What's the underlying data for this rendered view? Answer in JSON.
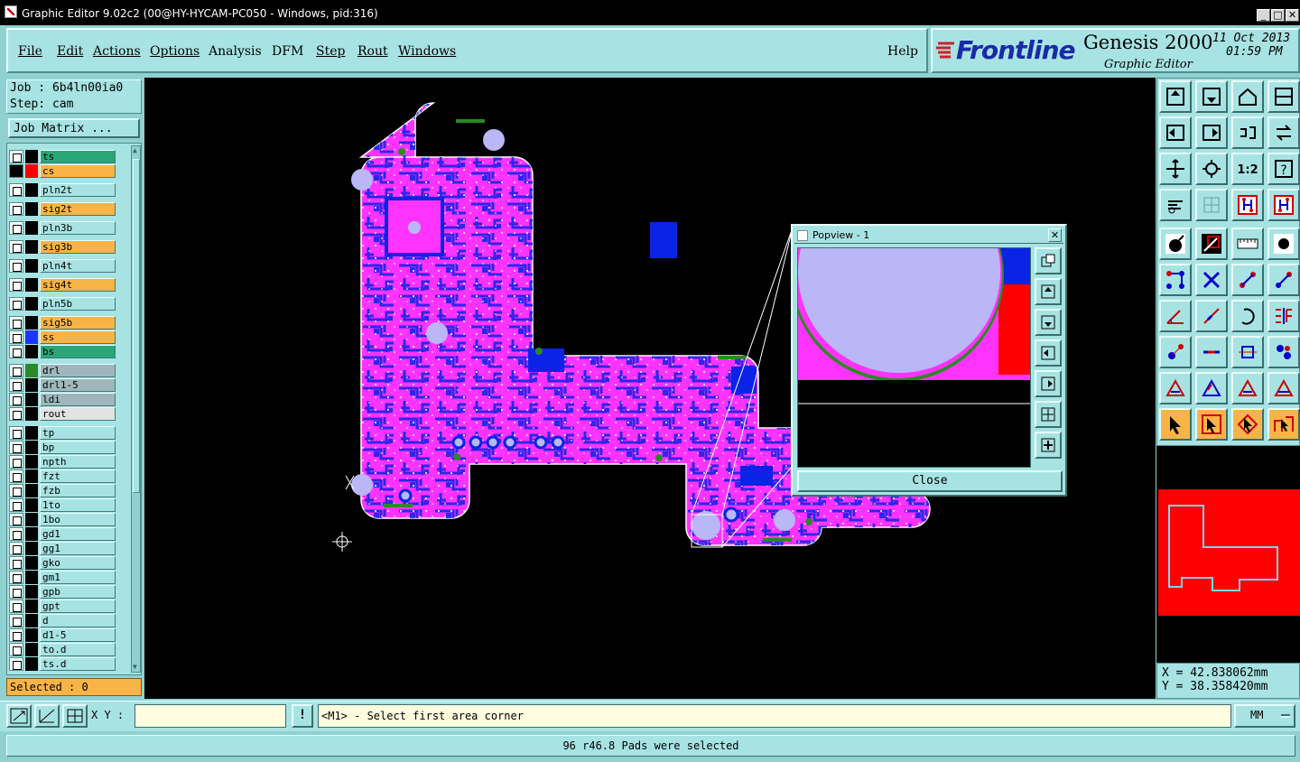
{
  "window": {
    "title": "Graphic Editor 9.02c2 (00@HY-HYCAM-PC050 - Windows, pid:316)",
    "controls": [
      "_",
      "□",
      "✕"
    ]
  },
  "menu": {
    "items": [
      {
        "label": "File"
      },
      {
        "label": "Edit"
      },
      {
        "label": "Actions"
      },
      {
        "label": "Options"
      },
      {
        "label": "Analysis"
      },
      {
        "label": "DFM"
      },
      {
        "label": "Step"
      },
      {
        "label": "Rout"
      },
      {
        "label": "Windows"
      }
    ],
    "help": "Help"
  },
  "brand": {
    "logo_text": "Frontline",
    "product": "Genesis 2000",
    "subtitle": "Graphic Editor",
    "date": "11 Oct 2013",
    "time": "01:59 PM"
  },
  "job": {
    "job_label": "Job : 6b4ln00ia0",
    "step_label": "Step: cam",
    "matrix_button": "Job Matrix ..."
  },
  "layers": [
    {
      "name": "ts",
      "swatch": "#000000",
      "bg": "#2aa676"
    },
    {
      "name": "cs",
      "swatch": "#ff0000",
      "bg": "#f9b447",
      "active": true
    },
    {
      "name": "pln2t",
      "swatch": "#000000",
      "bg": "#a8e3e3"
    },
    {
      "name": "sig2t",
      "swatch": "#000000",
      "bg": "#f9b447"
    },
    {
      "name": "pln3b",
      "swatch": "#000000",
      "bg": "#a8e3e3"
    },
    {
      "name": "sig3b",
      "swatch": "#000000",
      "bg": "#f9b447"
    },
    {
      "name": "pln4t",
      "swatch": "#000000",
      "bg": "#a8e3e3"
    },
    {
      "name": "sig4t",
      "swatch": "#000000",
      "bg": "#f9b447"
    },
    {
      "name": "pln5b",
      "swatch": "#000000",
      "bg": "#a8e3e3"
    },
    {
      "name": "sig5b",
      "swatch": "#000000",
      "bg": "#f9b447"
    },
    {
      "name": "ss",
      "swatch": "#1f33ff",
      "bg": "#f9b447"
    },
    {
      "name": "bs",
      "swatch": "#000000",
      "bg": "#2aa676"
    },
    {
      "name": "drl",
      "swatch": "#2a8a2a",
      "bg": "#9fb7bb"
    },
    {
      "name": "drl1-5",
      "swatch": "#000000",
      "bg": "#9fb7bb"
    },
    {
      "name": "ldi",
      "swatch": "#000000",
      "bg": "#9fb7bb"
    },
    {
      "name": "rout",
      "swatch": "#000000",
      "bg": "#e3e3e3"
    },
    {
      "name": "tp",
      "swatch": "#000000",
      "bg": "#a8e3e3"
    },
    {
      "name": "bp",
      "swatch": "#000000",
      "bg": "#a8e3e3"
    },
    {
      "name": "npth",
      "swatch": "#000000",
      "bg": "#a8e3e3"
    },
    {
      "name": "fzt",
      "swatch": "#000000",
      "bg": "#a8e3e3"
    },
    {
      "name": "fzb",
      "swatch": "#000000",
      "bg": "#a8e3e3"
    },
    {
      "name": "1to",
      "swatch": "#000000",
      "bg": "#a8e3e3"
    },
    {
      "name": "1bo",
      "swatch": "#000000",
      "bg": "#a8e3e3"
    },
    {
      "name": "gd1",
      "swatch": "#000000",
      "bg": "#a8e3e3"
    },
    {
      "name": "gg1",
      "swatch": "#000000",
      "bg": "#a8e3e3"
    },
    {
      "name": "gko",
      "swatch": "#000000",
      "bg": "#a8e3e3"
    },
    {
      "name": "gm1",
      "swatch": "#000000",
      "bg": "#a8e3e3"
    },
    {
      "name": "gpb",
      "swatch": "#000000",
      "bg": "#a8e3e3"
    },
    {
      "name": "gpt",
      "swatch": "#000000",
      "bg": "#a8e3e3"
    },
    {
      "name": "d",
      "swatch": "#000000",
      "bg": "#a8e3e3"
    },
    {
      "name": "d1-5",
      "swatch": "#000000",
      "bg": "#a8e3e3"
    },
    {
      "name": "to.d",
      "swatch": "#000000",
      "bg": "#a8e3e3"
    },
    {
      "name": "ts.d",
      "swatch": "#000000",
      "bg": "#a8e3e3"
    }
  ],
  "selected_count": "Selected : 0",
  "popview": {
    "title": "Popview - 1",
    "close": "Close"
  },
  "coords": {
    "x": "X = 42.838062mm",
    "y": "Y = 38.358420mm"
  },
  "statusbar": {
    "xy_label": "X Y :",
    "xy_value": "",
    "prompt": "<M1> - Select first area corner",
    "units": "MM",
    "message": "96 r46.8 Pads were selected"
  },
  "toolbar": {
    "icons": [
      "home-icon",
      "save-icon",
      "house-icon",
      "window-icon",
      "pan-left-icon",
      "pan-right-icon",
      "step-icon",
      "rotate-icon",
      "fit-icon",
      "zoom-icon",
      "ratio-label",
      "help-icon",
      "tools-icon",
      "grid-icon",
      "snap-icon",
      "snap2-icon",
      "pad-icon",
      "measure-icon",
      "ruler-icon",
      "circle-icon",
      "net-icon",
      "cross-icon",
      "arrow-icon",
      "arrow2-icon",
      "angle-icon",
      "line-icon",
      "rotate2-icon",
      "mirror-icon",
      "pad2-icon",
      "minus-icon",
      "box-icon",
      "group-icon",
      "triangle-icon",
      "triangle2-icon",
      "triangle3-icon",
      "triangle4-icon",
      "select-icon",
      "select2-icon",
      "select3-icon",
      "select4-icon"
    ],
    "ratio": "1:2"
  },
  "colors": {
    "panel": "#a8e3e3",
    "copper": "#ff33ff",
    "trace": "#0a23e6",
    "drill": "#b9b7f5",
    "status_orange": "#f9b447"
  }
}
